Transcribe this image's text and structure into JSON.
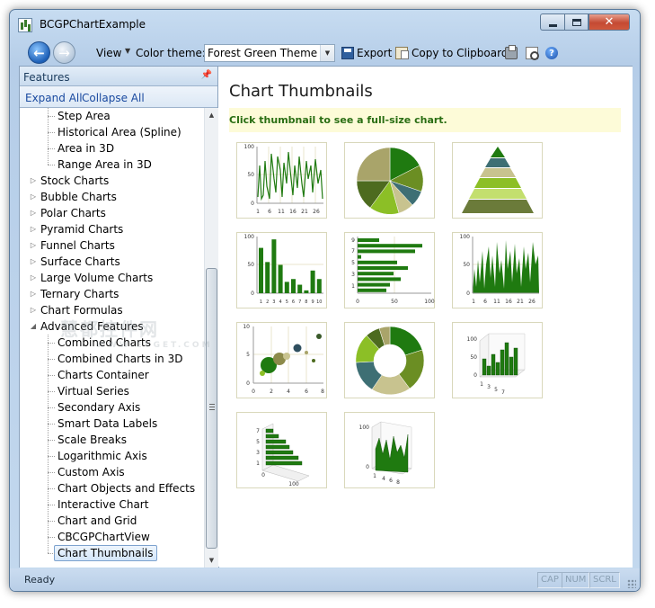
{
  "window": {
    "title": "BCGPChartExample"
  },
  "toolbar": {
    "view_label": "View",
    "color_theme_label": "Color theme:",
    "theme_value": "Forest Green Theme",
    "export_label": "Export",
    "copy_label": "Copy to Clipboard"
  },
  "features": {
    "header": "Features",
    "expand_all": "Expand All",
    "collapse_all": "Collapse All",
    "items": [
      {
        "label": "Step Area",
        "level": 2
      },
      {
        "label": "Historical Area (Spline)",
        "level": 2
      },
      {
        "label": "Area in 3D",
        "level": 2
      },
      {
        "label": "Range Area in 3D",
        "level": 2
      },
      {
        "label": "Stock Charts",
        "level": 1,
        "expander": "collapsed"
      },
      {
        "label": "Bubble Charts",
        "level": 1,
        "expander": "collapsed"
      },
      {
        "label": "Polar Charts",
        "level": 1,
        "expander": "collapsed"
      },
      {
        "label": "Pyramid Charts",
        "level": 1,
        "expander": "collapsed"
      },
      {
        "label": "Funnel Charts",
        "level": 1,
        "expander": "collapsed"
      },
      {
        "label": "Surface Charts",
        "level": 1,
        "expander": "collapsed"
      },
      {
        "label": "Large Volume Charts",
        "level": 1,
        "expander": "collapsed"
      },
      {
        "label": "Ternary Charts",
        "level": 1,
        "expander": "collapsed"
      },
      {
        "label": "Chart Formulas",
        "level": 1,
        "expander": "collapsed"
      },
      {
        "label": "Advanced Features",
        "level": 1,
        "expander": "expanded"
      },
      {
        "label": "Combined Charts",
        "level": 2
      },
      {
        "label": "Combined Charts in 3D",
        "level": 2
      },
      {
        "label": "Charts Container",
        "level": 2
      },
      {
        "label": "Virtual Series",
        "level": 2
      },
      {
        "label": "Secondary Axis",
        "level": 2
      },
      {
        "label": "Smart Data Labels",
        "level": 2
      },
      {
        "label": "Scale Breaks",
        "level": 2
      },
      {
        "label": "Logarithmic Axis",
        "level": 2
      },
      {
        "label": "Custom Axis",
        "level": 2
      },
      {
        "label": "Chart Objects and Effects",
        "level": 2
      },
      {
        "label": "Interactive Chart",
        "level": 2
      },
      {
        "label": "Chart and Grid",
        "level": 2
      },
      {
        "label": "CBCGPChartView",
        "level": 2
      },
      {
        "label": "Chart Thumbnails",
        "level": 2,
        "selected": true
      }
    ]
  },
  "main": {
    "title": "Chart Thumbnails",
    "hint": "Click thumbnail to see a full-size chart."
  },
  "thumbnails": {
    "line": {
      "y_ticks": [
        "100",
        "50",
        "0"
      ],
      "x_ticks": [
        "1",
        "6",
        "11",
        "16",
        "21",
        "26"
      ]
    },
    "bar": {
      "y_ticks": [
        "100",
        "50",
        "0"
      ],
      "x_ticks": [
        "1",
        "2",
        "3",
        "4",
        "5",
        "6",
        "7",
        "8",
        "9",
        "10"
      ],
      "values": [
        80,
        55,
        95,
        50,
        20,
        25,
        15,
        5,
        40,
        25
      ]
    },
    "hbar": {
      "y_ticks": [
        "9",
        "7",
        "5",
        "3",
        "1"
      ],
      "x_ticks": [
        "0",
        "50",
        "100"
      ],
      "values": [
        30,
        90,
        80,
        5,
        55,
        70,
        50,
        60,
        45,
        40
      ]
    },
    "area": {
      "y_ticks": [
        "100",
        "50",
        "0"
      ],
      "x_ticks": [
        "1",
        "6",
        "11",
        "16",
        "21",
        "26"
      ]
    },
    "bubble": {
      "y_ticks": [
        "10",
        "5",
        "0"
      ],
      "x_ticks": [
        "0",
        "2",
        "4",
        "6",
        "8"
      ]
    },
    "bar3d": {
      "y_ticks": [
        "100",
        "50",
        "0"
      ],
      "x_ticks": [
        "1",
        "3",
        "5",
        "7"
      ]
    },
    "hbar3d": {
      "y_ticks": [
        "7",
        "5",
        "3",
        "1"
      ],
      "x_ticks": [
        "0",
        "100"
      ]
    },
    "area3d": {
      "y_ticks": [
        "100",
        "0"
      ],
      "x_ticks": [
        "1",
        "4",
        "6",
        "8"
      ]
    }
  },
  "status": {
    "text": "Ready",
    "cap": "CAP",
    "num": "NUM",
    "scrl": "SCRL"
  },
  "watermark": {
    "line1": "慧都控件网",
    "line2": "WWW.EVGET.COM"
  },
  "colors": {
    "accent_dark": "#1f7a10",
    "accent_light": "#8cbf26",
    "olive": "#6b7b3a",
    "khaki": "#c8c38f",
    "teal": "#3e6f74"
  }
}
